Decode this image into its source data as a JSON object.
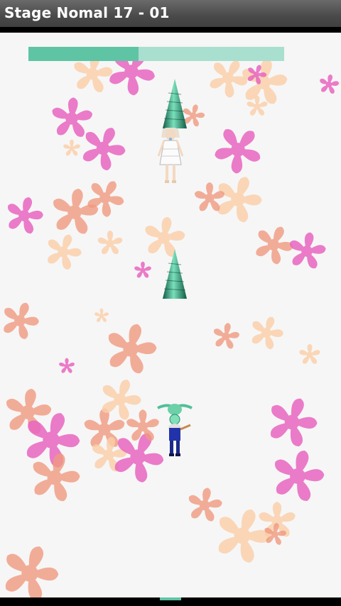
{
  "window": {
    "title": "Stage Nomal 17 - 01"
  },
  "boss": {
    "hp_fraction": 0.43
  },
  "colors": {
    "accent": "#5ec4a4",
    "accent_light": "#a9dfcf",
    "petal_pink": "#e866c0",
    "petal_salmon": "#f09a80",
    "petal_peach": "#fbcfa8",
    "field_background": "#f6f6f6"
  },
  "sprites": {
    "boss": "boss-girl-sprite",
    "player": "player-girl-sprite",
    "bullet": "green-cone-bullet"
  }
}
